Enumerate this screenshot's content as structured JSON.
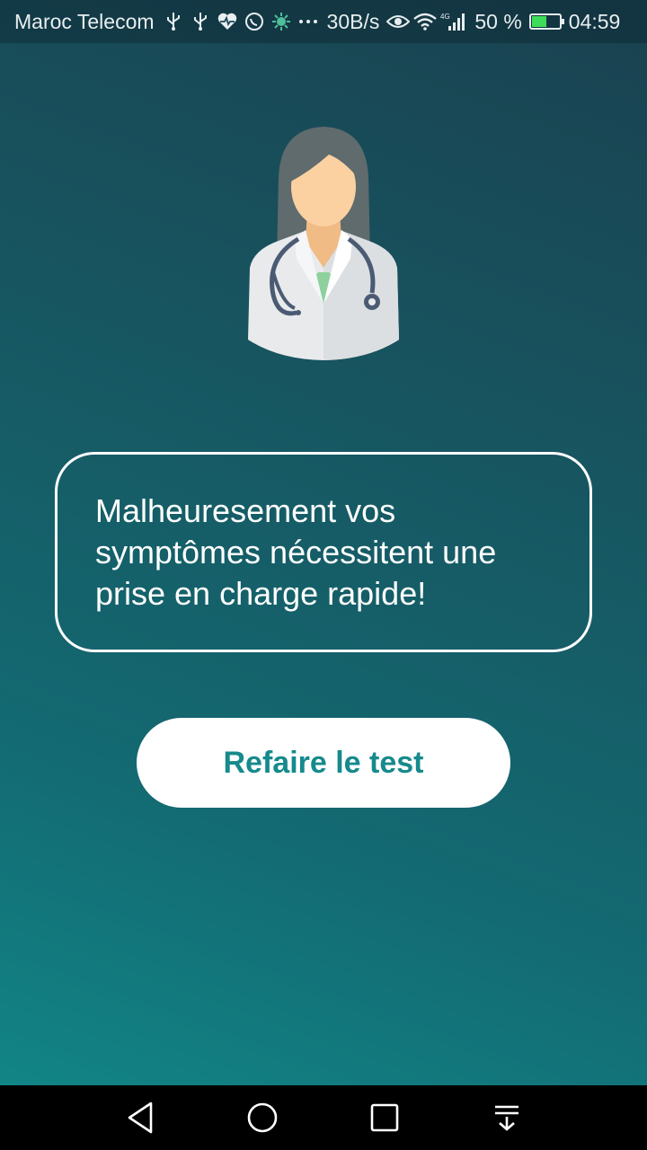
{
  "status_bar": {
    "carrier": "Maroc Telecom",
    "network_speed": "30B/s",
    "network_type": "4G",
    "battery_percent": "50 %",
    "battery_level": 0.5,
    "time": "04:59",
    "icons": [
      "usb-icon",
      "usb-icon",
      "heart-pulse-icon",
      "whatsapp-icon",
      "virus-icon",
      "more-dots-icon",
      "eye-icon",
      "wifi-icon",
      "signal-icon",
      "battery-charging-icon"
    ]
  },
  "illustration": {
    "name": "doctor-illustration"
  },
  "message": {
    "text": "Malheuresement vos symptômes nécessitent une prise en charge rapide!"
  },
  "actions": {
    "retry_label": "Refaire le test"
  },
  "nav_bar": {
    "buttons": [
      "back-icon",
      "home-icon",
      "recents-icon",
      "notification-pull-icon"
    ]
  },
  "colors": {
    "accent": "#168a8c",
    "background_top": "#1a4150",
    "background_bottom": "#118a8a"
  }
}
